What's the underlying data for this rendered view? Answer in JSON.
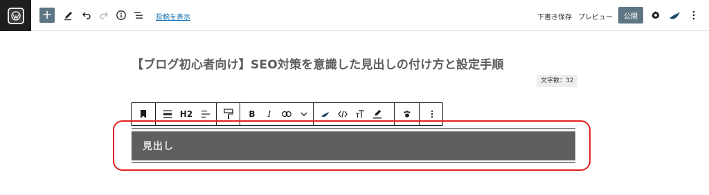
{
  "topbar": {
    "show_posts_label": "投稿を表示",
    "save_draft_label": "下書き保存",
    "preview_label": "プレビュー",
    "publish_label": "公開"
  },
  "post": {
    "title": "【ブログ初心者向け】SEO対策を意識した見出しの付け方と設定手順",
    "word_count": "文字数：32"
  },
  "block_toolbar": {
    "heading_level": "H2",
    "bold_label": "B",
    "italic_label": "I",
    "title_text_label": "T"
  },
  "heading_block": {
    "text": "見出し"
  },
  "colors": {
    "accent": "#5e7684",
    "link": "#1470b3",
    "heading_bg": "#5f5f5f",
    "highlight": "#e21f1f"
  }
}
